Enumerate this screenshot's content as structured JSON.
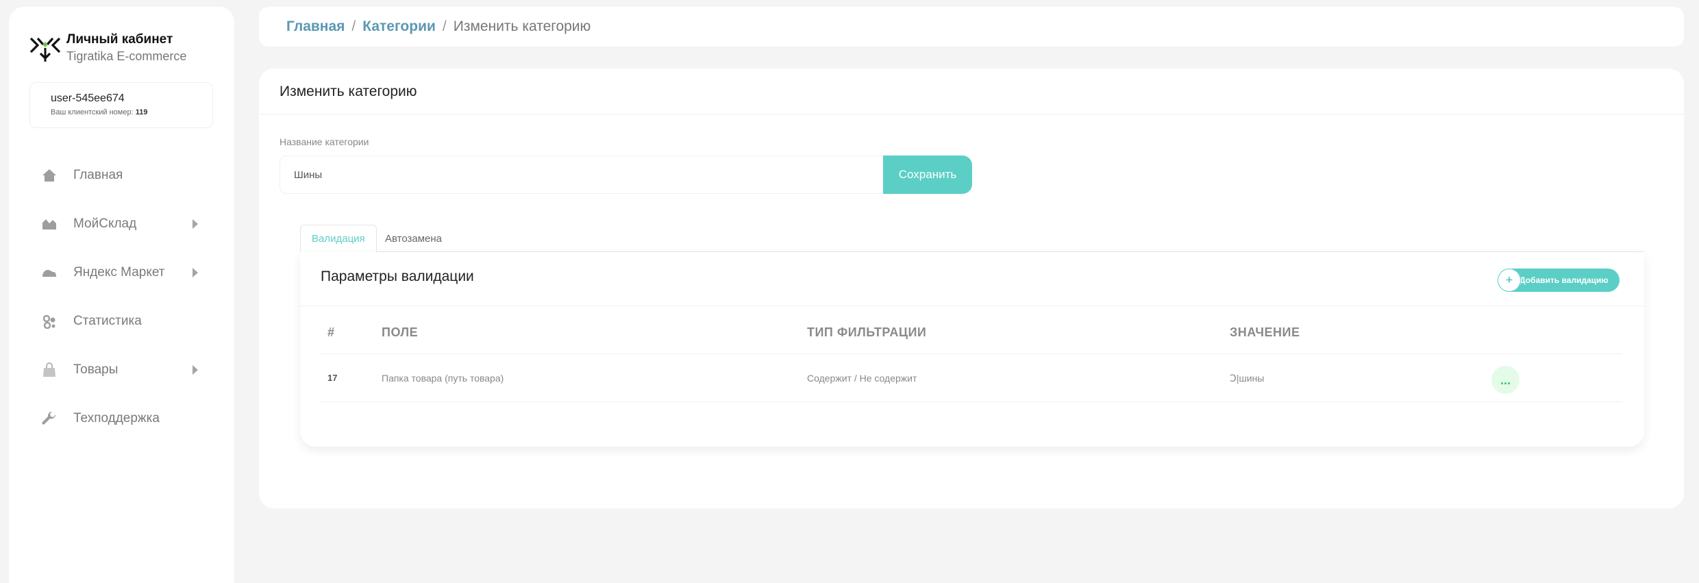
{
  "brand": {
    "title": "Личный кабинет",
    "subtitle": "Tigratika E-commerce"
  },
  "user": {
    "name": "user-545ee674",
    "client_label": "Ваш клиентский номер:",
    "client_number": "119"
  },
  "nav": {
    "items": [
      {
        "label": "Главная",
        "icon": "home-icon"
      },
      {
        "label": "МойСклад",
        "icon": "warehouse-icon",
        "has_submenu": true
      },
      {
        "label": "Яндекс Маркет",
        "icon": "market-icon",
        "has_submenu": true
      },
      {
        "label": "Статистика",
        "icon": "statistics-icon"
      },
      {
        "label": "Товары",
        "icon": "bag-icon",
        "has_submenu": true
      },
      {
        "label": "Техподдержка",
        "icon": "wrench-icon"
      }
    ]
  },
  "breadcrumb": {
    "home": "Главная",
    "categories": "Категории",
    "current": "Изменить категорию"
  },
  "form": {
    "title": "Изменить категорию",
    "name_label": "Название категории",
    "name_value": "Шины",
    "save_label": "Сохранить"
  },
  "tabs": {
    "validation": "Валидация",
    "autoreplace": "Автозамена",
    "active": "validation"
  },
  "validation": {
    "title": "Параметры валидации",
    "add_label": "Добавить валидацию",
    "columns": [
      "#",
      "ПОЛЕ",
      "ТИП ФИЛЬТРАЦИИ",
      "ЗНАЧЕНИЕ"
    ],
    "rows": [
      {
        "id": "17",
        "field": "Папка товара (путь товара)",
        "filter_type": "Содержит / Не содержит",
        "value": "Ↄ|шины",
        "action": "..."
      }
    ]
  },
  "colors": {
    "accent": "#5bcfc5",
    "link": "#5b97b3",
    "more_bg": "#e4fbe8",
    "more_fg": "#39c279"
  }
}
